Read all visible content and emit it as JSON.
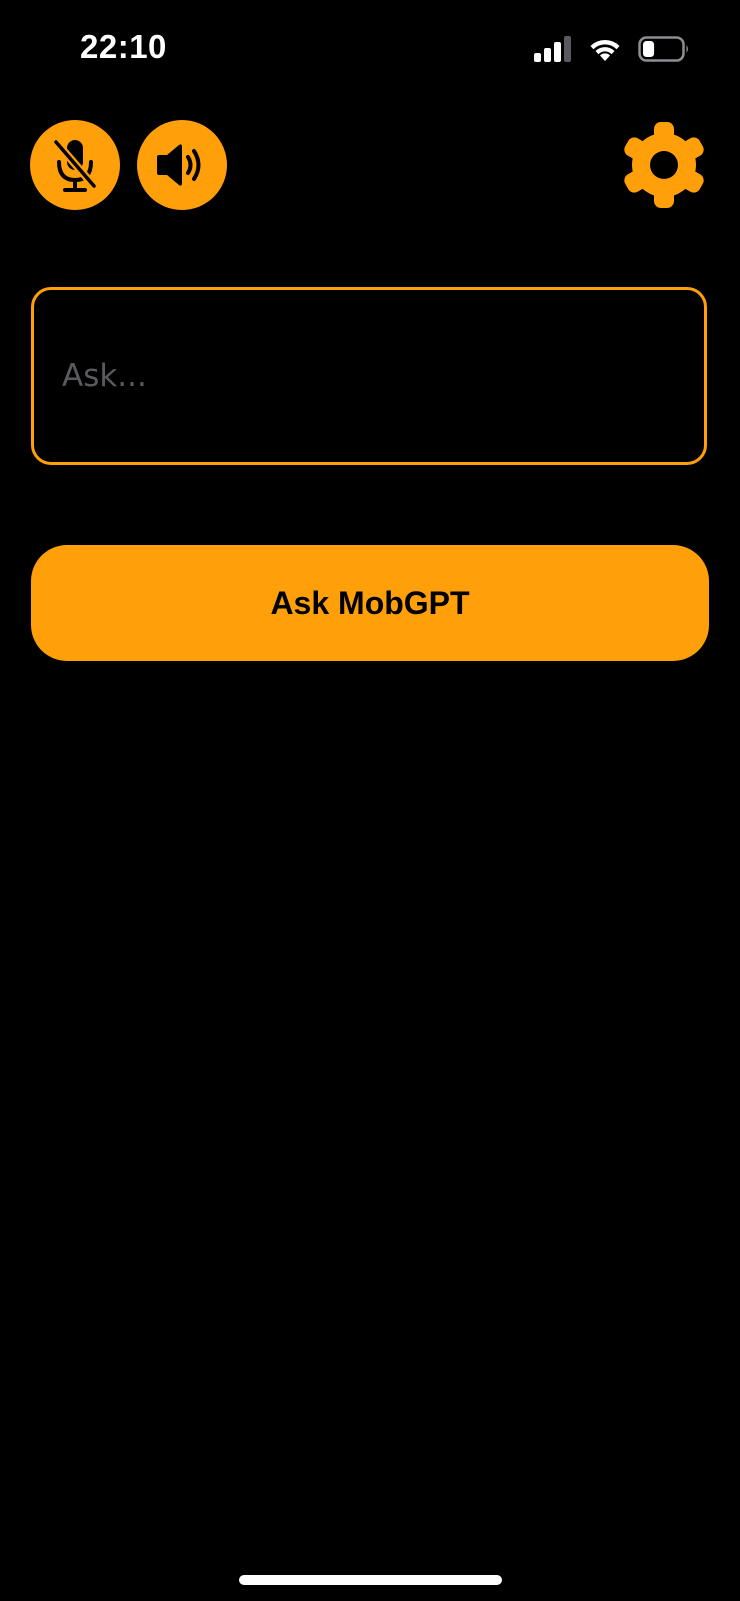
{
  "status_bar": {
    "time": "22:10",
    "icons": [
      "cellular-signal-icon",
      "wifi-icon",
      "battery-icon"
    ],
    "battery_level": 0.3
  },
  "toolbar": {
    "mic_icon": "microphone-slash-icon",
    "speaker_icon": "speaker-wave-icon",
    "settings_icon": "gear-icon"
  },
  "ask": {
    "placeholder": "Ask...",
    "value": ""
  },
  "ask_button": {
    "label": "Ask MobGPT"
  },
  "colors": {
    "accent": "#ff9f0a",
    "background": "#000000",
    "placeholder": "#5a5a5e"
  }
}
